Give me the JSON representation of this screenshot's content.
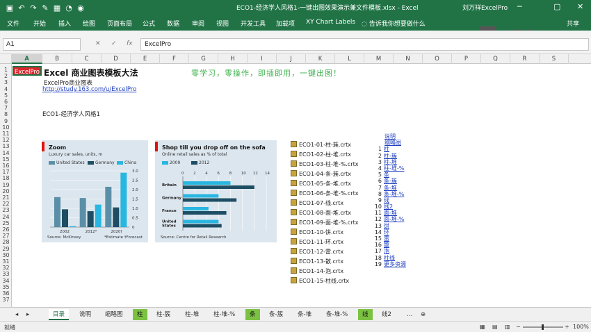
{
  "window": {
    "title": "ECO1-经济学人风格1-一键出图效果演示兼文件模板.xlsx - Excel",
    "user": "刘万祥ExcelPro",
    "controls": [
      "─",
      "▢",
      "✕"
    ],
    "qa_icons": [
      "save-icon",
      "undo-icon",
      "redo-icon",
      "paint-icon",
      "table-icon",
      "chart-icon",
      "camera-icon"
    ]
  },
  "ribbon": {
    "tabs": [
      "文件",
      "开始",
      "插入",
      "绘图",
      "页面布局",
      "公式",
      "数据",
      "审阅",
      "视图",
      "开发工具",
      "加载项",
      "XY Chart Labels"
    ],
    "tell_me": "告诉我你想要做什么",
    "share": "共享",
    "logo_text": "云课堂"
  },
  "formula_bar": {
    "name_box": "A1",
    "content": "ExcelPro",
    "cancel": "✕",
    "enter": "✓",
    "fx": "fx"
  },
  "columns": [
    "A",
    "B",
    "C",
    "D",
    "E",
    "F",
    "G",
    "H",
    "I",
    "J",
    "K",
    "L",
    "M",
    "N",
    "O",
    "P",
    "Q",
    "R",
    "S"
  ],
  "rows": [
    "1",
    "2",
    "3",
    "4",
    "5",
    "6",
    "7",
    "8",
    "9",
    "10",
    "11",
    "12",
    "13",
    "14",
    "15",
    "16",
    "17",
    "18",
    "19",
    "20",
    "21",
    "22",
    "23",
    "24",
    "25",
    "26",
    "27",
    "28",
    "29",
    "30",
    "31",
    "32",
    "33",
    "34",
    "35",
    "36",
    "37"
  ],
  "sheet": {
    "a1": "ExcelPro",
    "title": "Excel 商业图表模板大法",
    "slogan": "零学习，零操作，即插即用，一键出图！",
    "subtitle": "ExcelPro商业图表",
    "url": "http://study.163.com/u/ExcelPro",
    "code": "ECO1-经济学人风格1"
  },
  "chart1": {
    "title": "Zoom",
    "subtitle": "Luxury car sales, units, m",
    "legend": [
      "United States",
      "Germany",
      "China"
    ],
    "colors": [
      "#5b8fa8",
      "#1d4e63",
      "#29b6e0"
    ],
    "x_labels": [
      "2002",
      "2012*",
      "2020†"
    ],
    "y_ticks": [
      "3.0",
      "2.5",
      "2.0",
      "1.5",
      "1.0",
      "0.5",
      "0"
    ],
    "source": "Source: McKinsey",
    "note": "*Estimate  †Forecast",
    "chart_data": {
      "type": "bar",
      "categories": [
        "2002",
        "2012*",
        "2020†"
      ],
      "series": [
        {
          "name": "United States",
          "values": [
            1.6,
            1.55,
            2.15
          ]
        },
        {
          "name": "Germany",
          "values": [
            0.95,
            0.85,
            1.05
          ]
        },
        {
          "name": "China",
          "values": [
            0.05,
            1.2,
            2.9
          ]
        }
      ],
      "ylim": [
        0,
        3.0
      ]
    }
  },
  "chart2": {
    "title": "Shop till you drop off on the sofa",
    "subtitle": "Online retail sales as % of total",
    "legend": [
      "2009",
      "2012"
    ],
    "colors": [
      "#29b6e0",
      "#1d4e63"
    ],
    "x_ticks": [
      "0",
      "2",
      "4",
      "6",
      "8",
      "10",
      "12",
      "14"
    ],
    "categories": [
      "Britain",
      "Germany",
      "France",
      "United States"
    ],
    "source": "Source: Centre for Retail Research",
    "chart_data": {
      "type": "bar",
      "categories": [
        "Britain",
        "Germany",
        "France",
        "United States"
      ],
      "series": [
        {
          "name": "2009",
          "values": [
            8.0,
            6.0,
            4.3,
            6.0
          ]
        },
        {
          "name": "2012",
          "values": [
            12.0,
            9.0,
            7.3,
            6.5
          ]
        }
      ],
      "xlim": [
        0,
        14
      ]
    }
  },
  "files": [
    "ECO1-01-柱-簇.crtx",
    "ECO1-02-柱-堆.crtx",
    "ECO1-03-柱-堆-%.crtx",
    "ECO1-04-条-簇.crtx",
    "ECO1-05-条-堆.crtx",
    "ECO1-06-条-堆-%.crtx",
    "ECO1-07-线.crtx",
    "ECO1-08-面-堆.crtx",
    "ECO1-09-面-堆-%.crtx",
    "ECO1-10-饼.crtx",
    "ECO1-11-环.crtx",
    "ECO1-12-雷.crtx",
    "ECO1-13-散.crtx",
    "ECO1-14-泡.crtx",
    "ECO1-15-柱线.crtx"
  ],
  "index_links": {
    "header1": "说明",
    "header2": "缩略图",
    "items": [
      {
        "n": "1",
        "label": "柱"
      },
      {
        "n": "2",
        "label": "柱-簇"
      },
      {
        "n": "3",
        "label": "柱-堆"
      },
      {
        "n": "4",
        "label": "柱-堆-%"
      },
      {
        "n": "5",
        "label": "条"
      },
      {
        "n": "6",
        "label": "条-簇"
      },
      {
        "n": "7",
        "label": "条-堆"
      },
      {
        "n": "8",
        "label": "条-堆-%"
      },
      {
        "n": "9",
        "label": "线"
      },
      {
        "n": "10",
        "label": "线2"
      },
      {
        "n": "11",
        "label": "面-堆"
      },
      {
        "n": "12",
        "label": "面-堆-%"
      },
      {
        "n": "13",
        "label": "饼"
      },
      {
        "n": "14",
        "label": "环"
      },
      {
        "n": "15",
        "label": "雷"
      },
      {
        "n": "16",
        "label": "散"
      },
      {
        "n": "17",
        "label": "泡"
      },
      {
        "n": "18",
        "label": "柱线"
      },
      {
        "n": "19",
        "label": "更多资源"
      }
    ]
  },
  "sheet_tabs": [
    {
      "label": "目录",
      "style": "active"
    },
    {
      "label": "说明",
      "style": ""
    },
    {
      "label": "缩略图",
      "style": ""
    },
    {
      "label": "柱",
      "style": "green"
    },
    {
      "label": "柱-簇",
      "style": ""
    },
    {
      "label": "柱-堆",
      "style": ""
    },
    {
      "label": "柱-堆-%",
      "style": ""
    },
    {
      "label": "条",
      "style": "green"
    },
    {
      "label": "条-簇",
      "style": ""
    },
    {
      "label": "条-堆",
      "style": ""
    },
    {
      "label": "条-堆-%",
      "style": ""
    },
    {
      "label": "线",
      "style": "green"
    },
    {
      "label": "线2",
      "style": ""
    }
  ],
  "status": {
    "ready": "就绪",
    "zoom": "100%"
  }
}
